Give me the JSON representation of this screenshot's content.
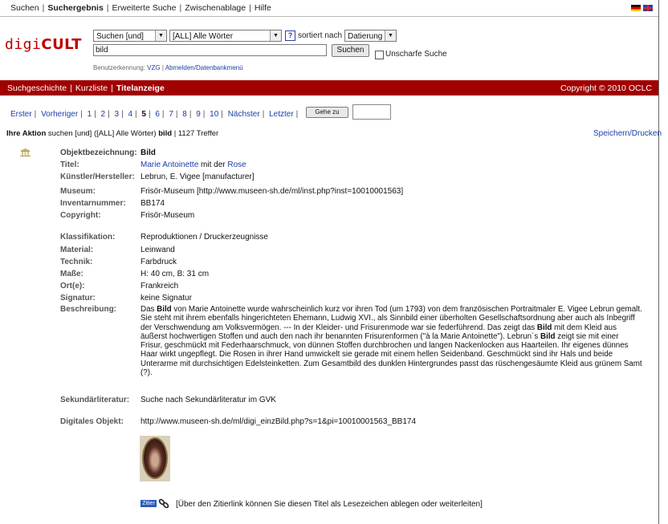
{
  "topnav": {
    "items": [
      "Suchen",
      "Suchergebnis",
      "Erweiterte Suche",
      "Zwischenablage",
      "Hilfe"
    ],
    "active": "Suchergebnis"
  },
  "logo": {
    "part1": "digi",
    "part2": "CULT"
  },
  "search": {
    "mode": "Suchen [und]",
    "field": "[ALL] Alle Wörter",
    "sort_label": "sortiert nach",
    "sort": "Datierung",
    "help": "?",
    "query": "bild",
    "button": "Suchen",
    "fuzzy_label": "Unscharfe Suche",
    "user_prefix": "Benutzerkennung:",
    "user_id": "VZG",
    "user_sep": "|",
    "logout": "Abmelden/Datenbankmenü"
  },
  "redbar": {
    "items": [
      "Suchgeschichte",
      "Kurzliste",
      "Titelanzeige"
    ],
    "active": "Titelanzeige",
    "copyright": "Copyright © 2010 OCLC"
  },
  "pager": {
    "first": "Erster",
    "prev": "Vorheriger",
    "pages": [
      "1",
      "2",
      "3",
      "4",
      "5",
      "6",
      "7",
      "8",
      "9",
      "10"
    ],
    "current": "5",
    "next": "Nächster",
    "last": "Letzter",
    "goto": "Gehe zu"
  },
  "action": {
    "label": "Ihre Aktion",
    "text": "suchen [und] ([ALL] Alle Wörter)",
    "term": "bild",
    "sep": "|",
    "hits": "1127 Treffer",
    "save": "Speichern/Drucken"
  },
  "record": {
    "objekt_label": "Objektbezeichnung:",
    "objekt": "Bild",
    "titel_label": "Titel:",
    "titel_part1": "Marie Antoinette",
    "titel_mid": " mit der ",
    "titel_part2": "Rose",
    "kuenstler_label": "Künstler/Hersteller:",
    "kuenstler": "Lebrun, E. Vigee [manufacturer]",
    "museum_label": "Museum:",
    "museum": "Frisör-Museum [http://www.museen-sh.de/ml/inst.php?inst=10010001563]",
    "inventar_label": "Inventarnummer:",
    "inventar": "BB174",
    "copyright_label": "Copyright:",
    "copyright": "Frisör-Museum",
    "klass_label": "Klassifikation:",
    "klass": "Reproduktionen / Druckerzeugnisse",
    "material_label": "Material:",
    "material": "Leinwand",
    "technik_label": "Technik:",
    "technik": "Farbdruck",
    "masse_label": "Maße:",
    "masse": "H: 40 cm, B: 31 cm",
    "ort_label": "Ort(e):",
    "ort": "Frankreich",
    "signatur_label": "Signatur:",
    "signatur": "keine Signatur",
    "beschreibung_label": "Beschreibung:",
    "desc_a": "Das ",
    "desc_b1": "Bild",
    "desc_c": " von Marie Antoinette wurde wahrscheinlich kurz vor ihren Tod (um 1793) von dem französischen Portraitmaler E. Vigee Lebrun gemalt. Sie steht mit ihrem ebenfalls hingerichteten Ehemann, Ludwig XVI., als Sinnbild einer überholten Gesellschaftsordnung aber auch als Inbegriff der Verschwendung am Volksvermögen. --- In der Kleider- und Frisurenmode war sie federführend. Das zeigt das ",
    "desc_b2": "Bild",
    "desc_d": " mit dem Kleid aus äußerst hochwertigen Stoffen und auch den nach ihr benannten Frisurenformen (\"à la Marie Antoinette\"). Lebrun´s ",
    "desc_b3": "Bild",
    "desc_e": " zeigt sie mit einer Frisur, geschmückt mit Federhaarschmuck, von dünnen Stoffen durchbrochen und langen Nackenlocken aus Haarteilen. Ihr eigenes dünnes Haar wirkt ungepflegt. Die Rosen in ihrer Hand umwickelt sie gerade mit einem hellen Seidenband. Geschmückt sind ihr Hals und beide Unterarme mit durchsichtigen Edelsteinketten. Zum Gesamtbild des dunklen Hintergrundes passt das rüschengesäumte Kleid aus grünem Samt (?).",
    "sekundaer_label": "Sekundärliteratur:",
    "sekundaer": "Suche nach Sekundärliteratur im GVK",
    "digital_label": "Digitales Objekt:",
    "digital": "http://www.museen-sh.de/ml/digi_einzBild.php?s=1&pi=10010001563_BB174",
    "cite_button": "Zitier",
    "cite_text": "[Über den Zitierlink können Sie diesen Titel als Lesezeichen ablegen oder weiterleiten]"
  },
  "colors": {
    "accent_red": "#a00000",
    "link_blue": "#1a3ea8",
    "logo_red": "#bb0000"
  }
}
